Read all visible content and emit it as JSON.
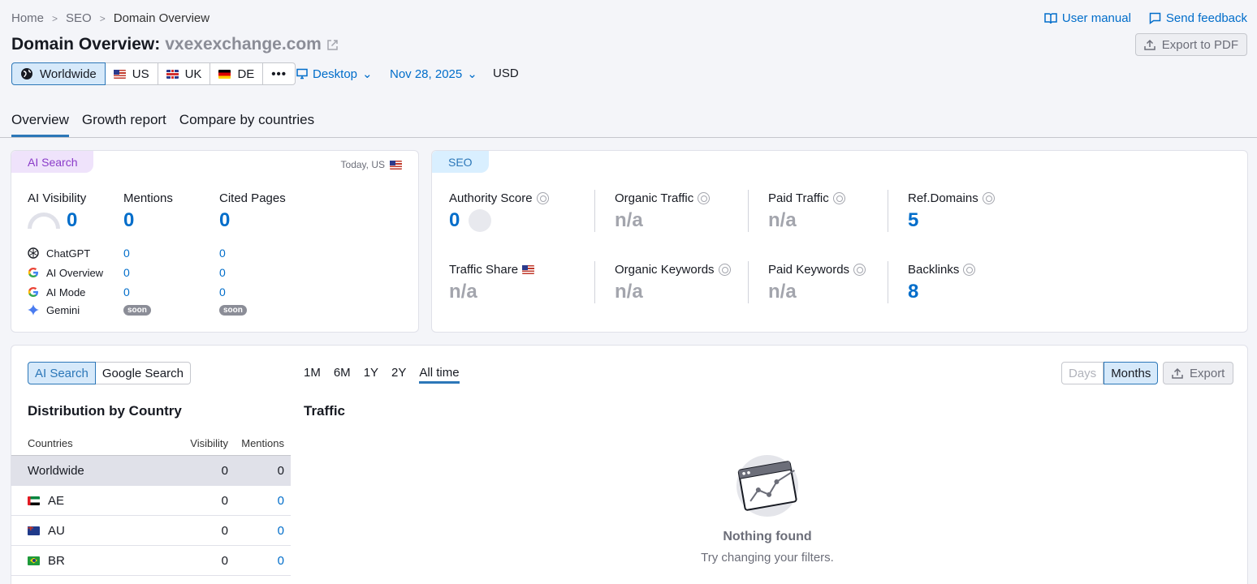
{
  "breadcrumb": {
    "items": [
      "Home",
      "SEO"
    ],
    "current": "Domain Overview"
  },
  "header_links": {
    "manual": "User manual",
    "feedback": "Send feedback"
  },
  "title": {
    "prefix": "Domain Overview:",
    "domain": "vxexexchange.com"
  },
  "export_pdf": "Export to PDF",
  "databases": [
    {
      "label": "Worldwide",
      "icon": "globe-icon"
    },
    {
      "label": "US",
      "icon": "flag-us"
    },
    {
      "label": "UK",
      "icon": "flag-uk"
    },
    {
      "label": "DE",
      "icon": "flag-de"
    }
  ],
  "device": "Desktop",
  "date": "Nov 28, 2025",
  "currency": "USD",
  "tabs": [
    "Overview",
    "Growth report",
    "Compare by countries"
  ],
  "ai_card": {
    "chip": "AI Search",
    "date_label": "Today, US",
    "metrics": [
      {
        "label": "AI Visibility",
        "value": "0"
      },
      {
        "label": "Mentions",
        "value": "0"
      },
      {
        "label": "Cited Pages",
        "value": "0"
      }
    ],
    "llms": [
      {
        "name": "ChatGPT",
        "mentions": "0",
        "cited": "0"
      },
      {
        "name": "AI Overview",
        "mentions": "0",
        "cited": "0"
      },
      {
        "name": "AI Mode",
        "mentions": "0",
        "cited": "0"
      },
      {
        "name": "Gemini",
        "mentions": "soon",
        "cited": "soon"
      }
    ]
  },
  "seo_card": {
    "chip": "SEO",
    "metrics": [
      {
        "label": "Authority Score",
        "value": "0"
      },
      {
        "label": "Organic Traffic",
        "value": "n/a"
      },
      {
        "label": "Paid Traffic",
        "value": "n/a"
      },
      {
        "label": "Ref.Domains",
        "value": "5"
      },
      {
        "label": "Traffic Share",
        "value": "n/a"
      },
      {
        "label": "Organic Keywords",
        "value": "n/a"
      },
      {
        "label": "Paid Keywords",
        "value": "n/a"
      },
      {
        "label": "Backlinks",
        "value": "8"
      }
    ]
  },
  "bottom": {
    "source_toggle": [
      "AI Search",
      "Google Search"
    ],
    "ranges": [
      "1M",
      "6M",
      "1Y",
      "2Y",
      "All time"
    ],
    "granularity": [
      "Days",
      "Months"
    ],
    "export": "Export",
    "distribution_title": "Distribution by Country",
    "traffic_title": "Traffic",
    "table": {
      "headers": [
        "Countries",
        "Visibility",
        "Mentions"
      ],
      "rows": [
        {
          "country": "Worldwide",
          "visibility": "0",
          "mentions": "0"
        },
        {
          "country": "AE",
          "visibility": "0",
          "mentions": "0"
        },
        {
          "country": "AU",
          "visibility": "0",
          "mentions": "0"
        },
        {
          "country": "BR",
          "visibility": "0",
          "mentions": "0"
        }
      ]
    },
    "empty": {
      "title": "Nothing found",
      "hint": "Try changing your filters."
    }
  }
}
